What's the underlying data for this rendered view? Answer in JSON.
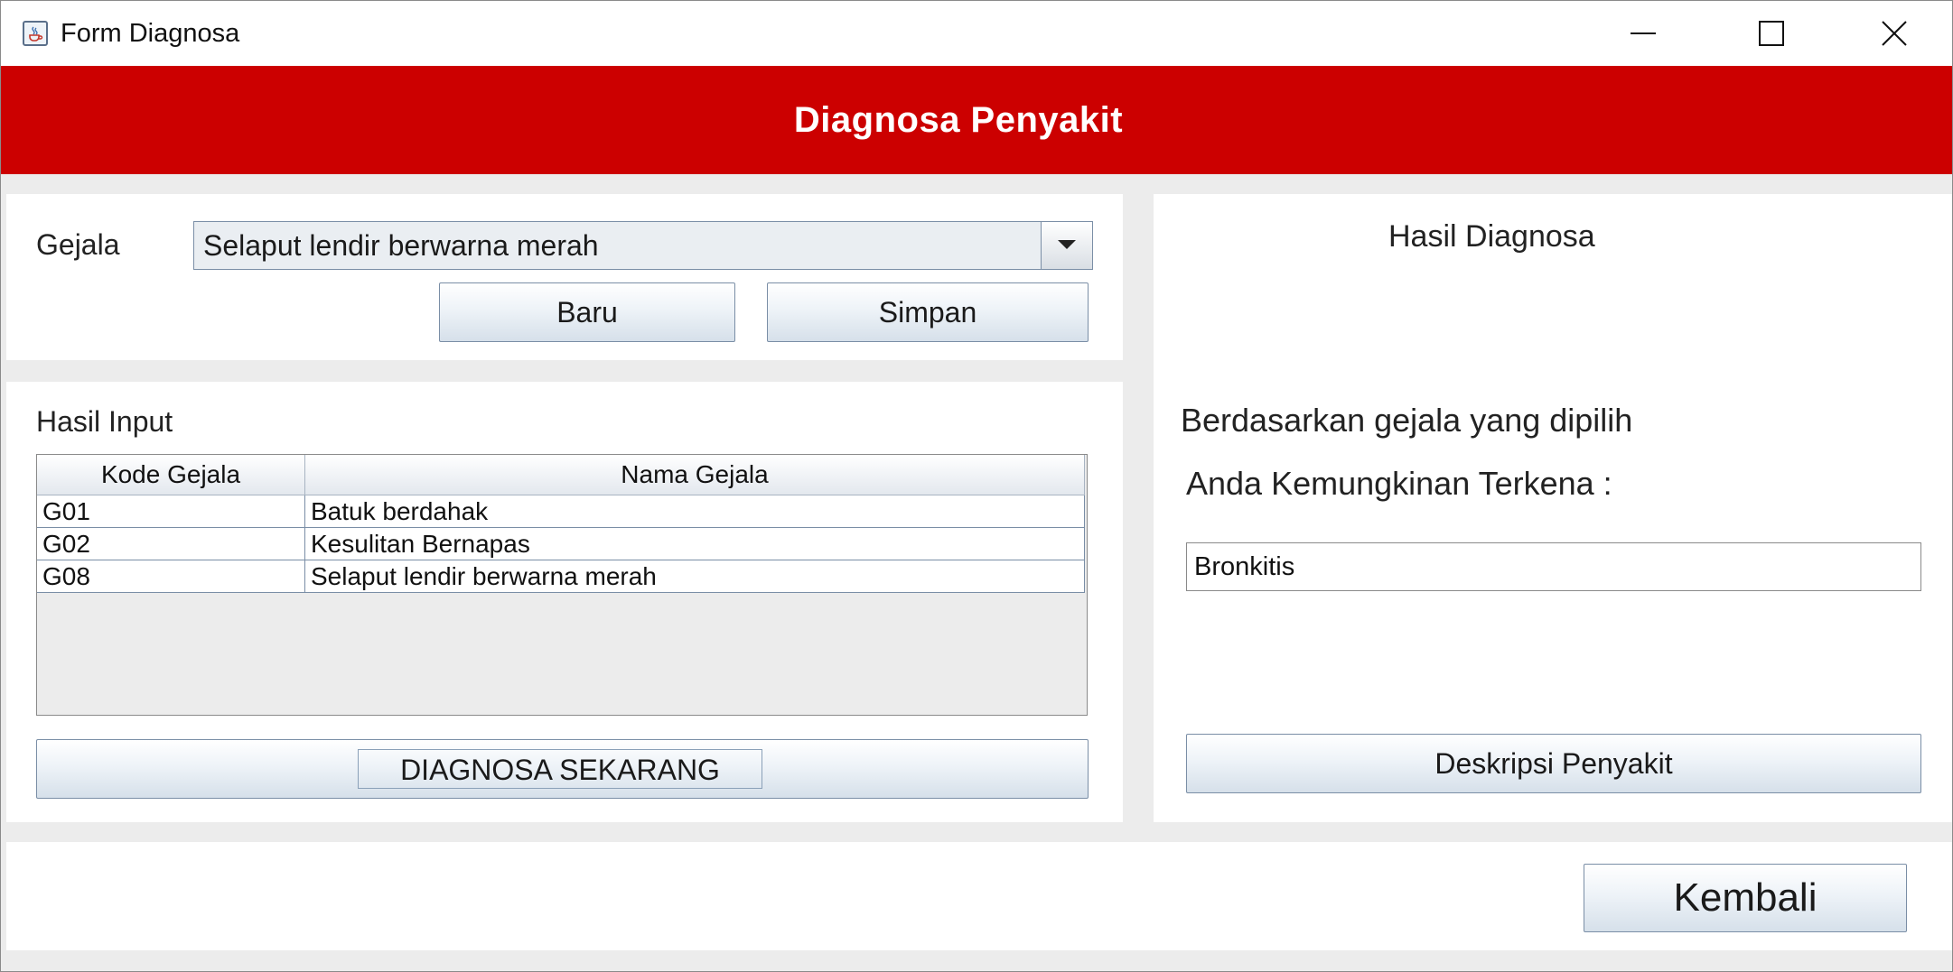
{
  "window": {
    "title": "Form Diagnosa",
    "icon": "java-cup-icon"
  },
  "header": {
    "title": "Diagnosa Penyakit",
    "background_color": "#cc0000"
  },
  "input_section": {
    "gejala_label": "Gejala",
    "gejala_selected": "Selaput lendir berwarna merah",
    "baru_label": "Baru",
    "simpan_label": "Simpan"
  },
  "hasil_input": {
    "title": "Hasil Input",
    "columns": [
      "Kode Gejala",
      "Nama Gejala"
    ],
    "rows": [
      [
        "G01",
        "Batuk berdahak"
      ],
      [
        "G02",
        "Kesulitan Bernapas"
      ],
      [
        "G08",
        "Selaput lendir berwarna merah"
      ]
    ],
    "diagnosa_button_label": "DIAGNOSA SEKARANG"
  },
  "hasil_diagnosa": {
    "title": "Hasil Diagnosa",
    "line1": "Berdasarkan gejala yang dipilih",
    "line2": "Anda Kemungkinan Terkena :",
    "result_value": "Bronkitis",
    "deskripsi_label": "Deskripsi Penyakit"
  },
  "footer": {
    "kembali_label": "Kembali"
  }
}
